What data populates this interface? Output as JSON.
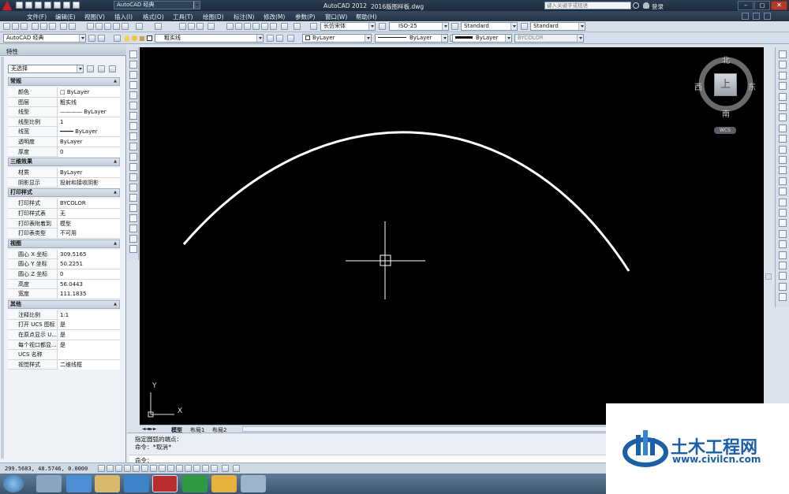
{
  "titlebar": {
    "workspace": "AutoCAD 经典",
    "app_title": "AutoCAD 2012",
    "file_name": "2016版图样板.dwg",
    "search_placeholder": "键入关键字或短语",
    "login": "登录"
  },
  "menu": [
    "文件(F)",
    "编辑(E)",
    "视图(V)",
    "插入(I)",
    "格式(O)",
    "工具(T)",
    "绘图(D)",
    "标注(N)",
    "修改(M)",
    "参数(P)",
    "窗口(W)",
    "帮助(H)"
  ],
  "toolbar": {
    "text_style": "长仿宋体",
    "dim_style": "ISO-25",
    "table_style": "Standard",
    "mleader_style": "Standard",
    "workspace_combo": "AutoCAD 经典",
    "layer": "粗实线",
    "color": "ByLayer",
    "linetype": "ByLayer",
    "lineweight": "ByLayer",
    "plotstyle": "BYCOLOR"
  },
  "properties": {
    "title": "特性",
    "selection": "无选择",
    "sections": [
      {
        "name": "常规",
        "rows": [
          [
            "颜色",
            "□ ByLayer"
          ],
          [
            "图层",
            "粗实线"
          ],
          [
            "线型",
            "———— ByLayer"
          ],
          [
            "线型比例",
            "1"
          ],
          [
            "线宽",
            "━━━━ ByLayer"
          ],
          [
            "透明度",
            "ByLayer"
          ],
          [
            "厚度",
            "0"
          ]
        ]
      },
      {
        "name": "三维效果",
        "rows": [
          [
            "材质",
            "ByLayer"
          ],
          [
            "阴影显示",
            "投射和接收阴影"
          ]
        ]
      },
      {
        "name": "打印样式",
        "rows": [
          [
            "打印样式",
            "BYCOLOR"
          ],
          [
            "打印样式表",
            "无"
          ],
          [
            "打印表附着到",
            "模型"
          ],
          [
            "打印表类型",
            "不可用"
          ]
        ]
      },
      {
        "name": "视图",
        "rows": [
          [
            "圆心 X 坐标",
            "309.5165"
          ],
          [
            "圆心 Y 坐标",
            "50.2251"
          ],
          [
            "圆心 Z 坐标",
            "0"
          ],
          [
            "高度",
            "56.0443"
          ],
          [
            "宽度",
            "111.1835"
          ]
        ]
      },
      {
        "name": "其他",
        "rows": [
          [
            "注释比例",
            "1:1"
          ],
          [
            "打开 UCS 图标",
            "是"
          ],
          [
            "在原点显示 U...",
            "是"
          ],
          [
            "每个视口都显...",
            "是"
          ],
          [
            "UCS 名称",
            ""
          ],
          [
            "视觉样式",
            "二维线框"
          ]
        ]
      }
    ]
  },
  "viewcube": {
    "north": "北",
    "south": "南",
    "east": "东",
    "west": "西",
    "top": "上",
    "ucs": "WCS"
  },
  "ucs_axes": {
    "x": "X",
    "y": "Y"
  },
  "layout_tabs": [
    "模型",
    "布局1",
    "布局2"
  ],
  "command": {
    "line1": "指定圆弧的端点：",
    "line2": "命令：*取消*",
    "prompt": "命令："
  },
  "status": {
    "coords": "299.5683,  48.5746,  0.0000"
  },
  "watermark": {
    "name": "土木工程网",
    "url": "www.civilcn.com"
  }
}
